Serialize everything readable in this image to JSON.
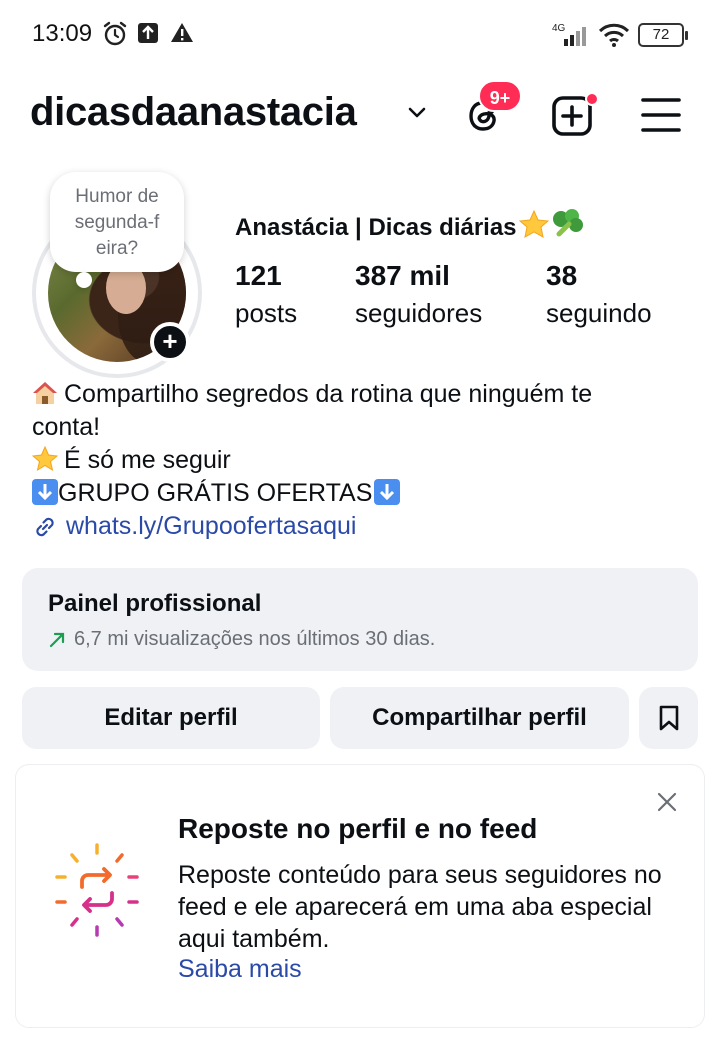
{
  "status_bar": {
    "time": "13:09",
    "network": "4G",
    "battery": "72"
  },
  "header": {
    "username": "dicasdaanastacia",
    "threads_badge": "9+",
    "icons": [
      "chevron-down-icon",
      "threads-icon",
      "add-post-icon",
      "menu-icon"
    ]
  },
  "profile": {
    "note_text": "Humor de segunda-f eira?",
    "note_lines": [
      "Humor de",
      "segunda-f",
      "eira?"
    ],
    "full_name": "Anastácia | Dicas diárias",
    "stats": [
      {
        "value": "121",
        "label": "posts"
      },
      {
        "value": "387 mil",
        "label": "seguidores"
      },
      {
        "value": "38",
        "label": "seguindo"
      }
    ]
  },
  "bio": {
    "line1": "Compartilho segredos da rotina que ninguém te",
    "line2": "conta!",
    "line3": "É só me seguir",
    "line4": "GRUPO GRÁTIS OFERTAS",
    "link": "whats.ly/Grupoofertasaqui"
  },
  "pro_panel": {
    "title": "Painel profissional",
    "subtitle": "6,7 mi visualizações nos últimos 30 dias."
  },
  "actions": {
    "edit": "Editar perfil",
    "share": "Compartilhar perfil"
  },
  "repost_card": {
    "title": "Reposte no perfil e no feed",
    "body": "Reposte conteúdo para seus seguidores no feed e ele aparecerá em uma aba especial aqui também.",
    "link": "Saiba mais"
  },
  "colors": {
    "badge": "#ff2d55",
    "link": "#2b4aa8",
    "panel_bg": "#eff1f5",
    "trend_arrow": "#1a9e52"
  }
}
